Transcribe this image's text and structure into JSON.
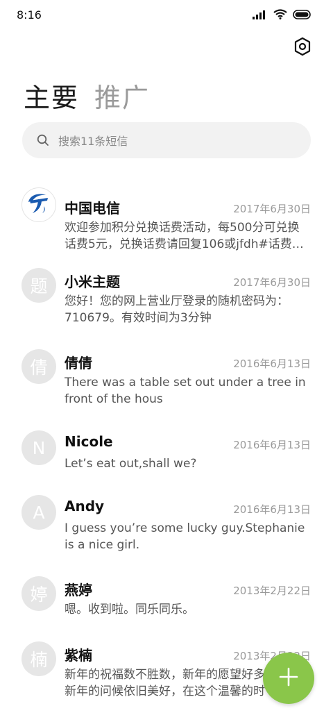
{
  "status_bar": {
    "time": "8:16"
  },
  "tabs": [
    {
      "label": "主要",
      "active": true
    },
    {
      "label": "推广",
      "active": false
    }
  ],
  "search": {
    "placeholder": "搜索11条短信"
  },
  "messages": [
    {
      "avatar": "",
      "avatar_icon": "china-telecom-logo",
      "name": "中国电信",
      "date": "2017年6月30日",
      "preview_line1": "欢迎参加积分兑换话费活动，每500分可兑换",
      "preview_line2": "话费5元，兑换话费请回复106或jfdh#话费…"
    },
    {
      "avatar": "题",
      "name": "小米主题",
      "date": "2017年6月30日",
      "preview_line1": "您好！您的网上营业厅登录的随机密码为：",
      "preview_line2": "710679。有效时间为3分钟"
    },
    {
      "avatar": "倩",
      "name": "倩倩",
      "date": "2016年6月13日",
      "preview_line1": "There was a table set out under a tree in",
      "preview_line2": "front of the hous"
    },
    {
      "avatar": "N",
      "name": "Nicole",
      "date": "2016年6月13日",
      "preview_line1": "Let’s eat out,shall we?",
      "preview_line2": ""
    },
    {
      "avatar": "A",
      "name": "Andy",
      "date": "2016年6月13日",
      "preview_line1": "I guess you’re some lucky guy.Stephanie",
      "preview_line2": "is a nice girl."
    },
    {
      "avatar": "婷",
      "name": "燕婷",
      "date": "2013年2月22日",
      "preview_line1": "嗯。收到啦。同乐同乐。",
      "preview_line2": ""
    },
    {
      "avatar": "楠",
      "name": "紫楠",
      "date": "2013年2月22日",
      "preview_line1": "新年的祝福数不胜数，新年的愿望好多",
      "preview_line2": "新年的问候依旧美好，在这个温馨的时"
    }
  ],
  "fab": {
    "icon": "plus-icon",
    "color": "#8ac64a"
  }
}
